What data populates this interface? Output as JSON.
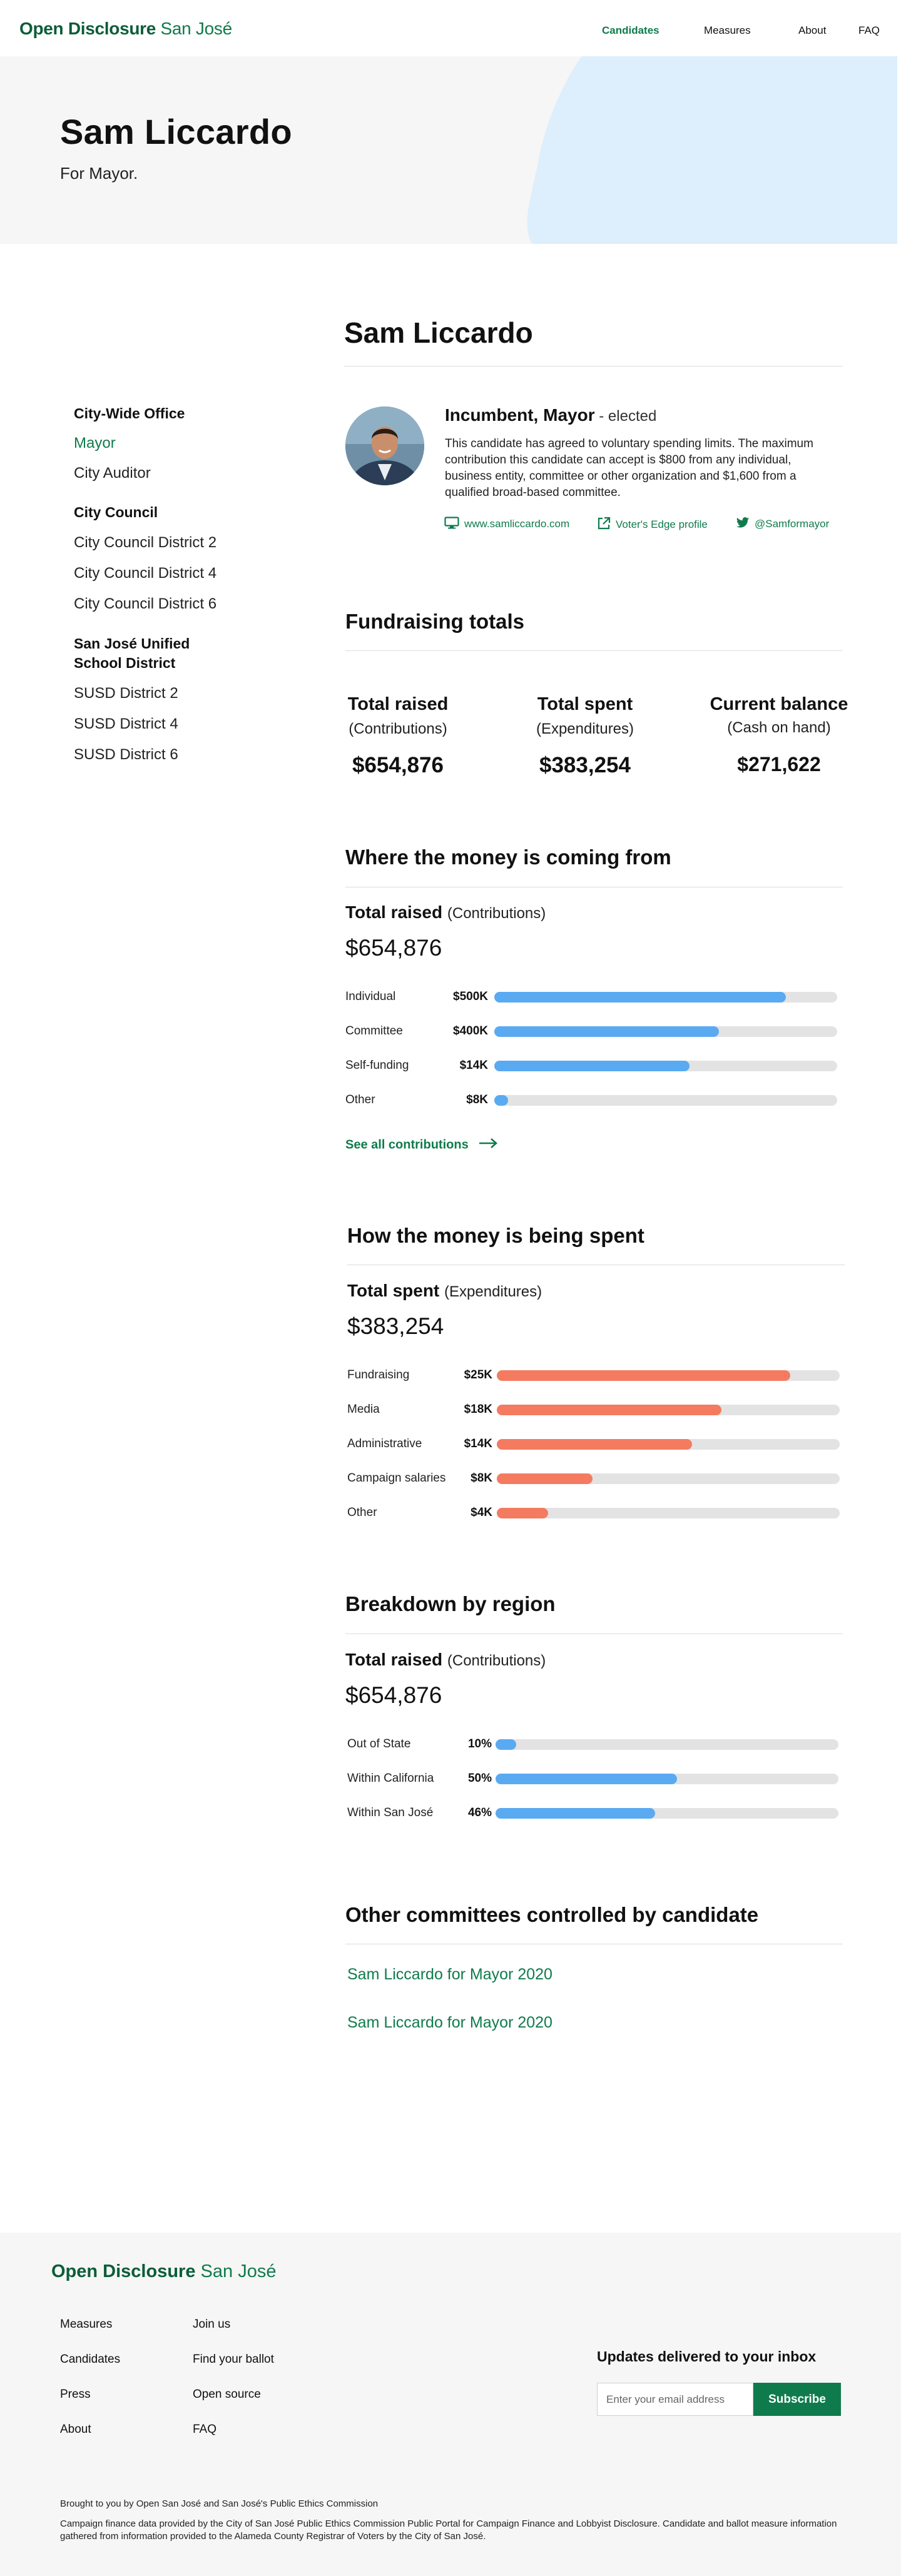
{
  "nav": {
    "logo_bold": "Open Disclosure",
    "logo_light": "San José",
    "links": [
      "Candidates",
      "Measures",
      "About",
      "FAQ"
    ]
  },
  "hero": {
    "title": "Sam Liccardo",
    "subtitle": "For Mayor."
  },
  "sidebar": {
    "groups": [
      {
        "title": "City-Wide Office",
        "items": [
          "Mayor",
          "City Auditor"
        ]
      },
      {
        "title": "City Council",
        "items": [
          "City Council District 2",
          "City Council District 4",
          "City Council District 6"
        ]
      },
      {
        "title": "San José Unified School District",
        "items": [
          "SUSD District 2",
          "SUSD District 4",
          "SUSD District 6"
        ]
      }
    ]
  },
  "candidate": {
    "name": "Sam Liccardo",
    "office": "Incumbent, Mayor",
    "status": " - elected",
    "pledge": "This candidate has agreed to voluntary spending limits. The maximum contribution this candidate can accept is $800 from any individual, business entity, committee or other organization and $1,600 from a qualified broad-based committee.",
    "links": {
      "website": "www.samliccardo.com",
      "voters_edge": "Voter's Edge profile",
      "twitter": "@Samformayor"
    }
  },
  "fundraising": {
    "title": "Fundraising totals",
    "stats": [
      {
        "head": "Total raised",
        "sub": "(Contributions)",
        "value": "$654,876"
      },
      {
        "head": "Total spent",
        "sub": "(Expenditures)",
        "value": "$383,254"
      },
      {
        "head": "Current balance",
        "sub": "(Cash on hand)",
        "value": "$271,622"
      }
    ]
  },
  "coming_from": {
    "title": "Where the money is coming from",
    "total_label": "Total raised",
    "total_paren": "(Contributions)",
    "total_value": "$654,876",
    "see_all": "See all contributions"
  },
  "being_spent": {
    "title": "How the money is being spent",
    "total_label": "Total spent",
    "total_paren": "(Expenditures)",
    "total_value": "$383,254"
  },
  "by_region": {
    "title": "Breakdown by region",
    "total_label": "Total raised",
    "total_paren": "(Contributions)",
    "total_value": "$654,876"
  },
  "committees": {
    "title": "Other committees controlled by candidate",
    "items": [
      "Sam Liccardo for Mayor 2020",
      "Sam Liccardo for Mayor 2020"
    ]
  },
  "chart_data": [
    {
      "type": "bar",
      "categories": [
        "Individual",
        "Committee",
        "Self-funding",
        "Other"
      ],
      "value_labels": [
        "$500K",
        "$400K",
        "$14K",
        "$8K"
      ],
      "values": [
        0.85,
        0.655,
        0.57,
        0.04
      ],
      "color": "#5aaaf2"
    },
    {
      "type": "bar",
      "categories": [
        "Fundraising",
        "Media",
        "Administrative",
        "Campaign salaries",
        "Other"
      ],
      "value_labels": [
        "$25K",
        "$18K",
        "$14K",
        "$8K",
        "$4K"
      ],
      "values": [
        0.855,
        0.655,
        0.57,
        0.28,
        0.15
      ],
      "color": "#f47b60"
    },
    {
      "type": "bar",
      "categories": [
        "Out of State",
        "Within California",
        "Within San José"
      ],
      "value_labels": [
        "10%",
        "50%",
        "46%"
      ],
      "values": [
        0.06,
        0.53,
        0.465
      ],
      "color": "#5aaaf2"
    }
  ],
  "footer": {
    "logo_bold": "Open Disclosure",
    "logo_light": "San José",
    "col1": [
      "Measures",
      "Candidates",
      "Press",
      "About"
    ],
    "col2": [
      "Join us",
      "Find your ballot",
      "Open source",
      "FAQ"
    ],
    "updates_title": "Updates delivered to your inbox",
    "email_placeholder": "Enter your email address",
    "subscribe": "Subscribe",
    "credit": "Brought to you by Open San José and San José's Public Ethics Commission",
    "disclaimer": "Campaign finance data provided by the City of San José Public Ethics Commission Public Portal for Campaign Finance and Lobbyist Disclosure. Candidate and ballot measure information gathered from information provided to the Alameda County Registrar of Voters by the City of San José."
  },
  "colors": {
    "brand_green": "#0f7b4c",
    "contribution_blue": "#5aaaf2",
    "expenditure_red": "#f47b60",
    "hero_blob": "#ddeefc"
  }
}
